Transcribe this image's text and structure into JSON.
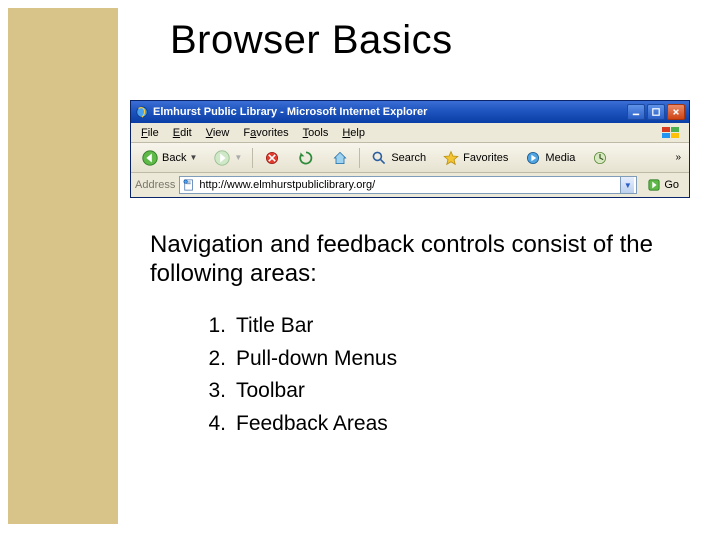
{
  "slide": {
    "title": "Browser Basics",
    "body": "Navigation and feedback controls consist of the following areas:",
    "items": [
      {
        "num": "1.",
        "label": "Title Bar"
      },
      {
        "num": "2.",
        "label": "Pull-down Menus"
      },
      {
        "num": "3.",
        "label": "Toolbar"
      },
      {
        "num": "4.",
        "label": "Feedback Areas"
      }
    ]
  },
  "browser": {
    "title": "Elmhurst Public Library - Microsoft Internet Explorer",
    "menus": {
      "file": "File",
      "edit": "Edit",
      "view": "View",
      "favorites": "Favorites",
      "tools": "Tools",
      "help": "Help"
    },
    "toolbar": {
      "back": "Back",
      "search": "Search",
      "favorites": "Favorites",
      "media": "Media",
      "overflow": "»"
    },
    "address": {
      "label": "Address",
      "url": "http://www.elmhurstpubliclibrary.org/",
      "go": "Go"
    }
  }
}
